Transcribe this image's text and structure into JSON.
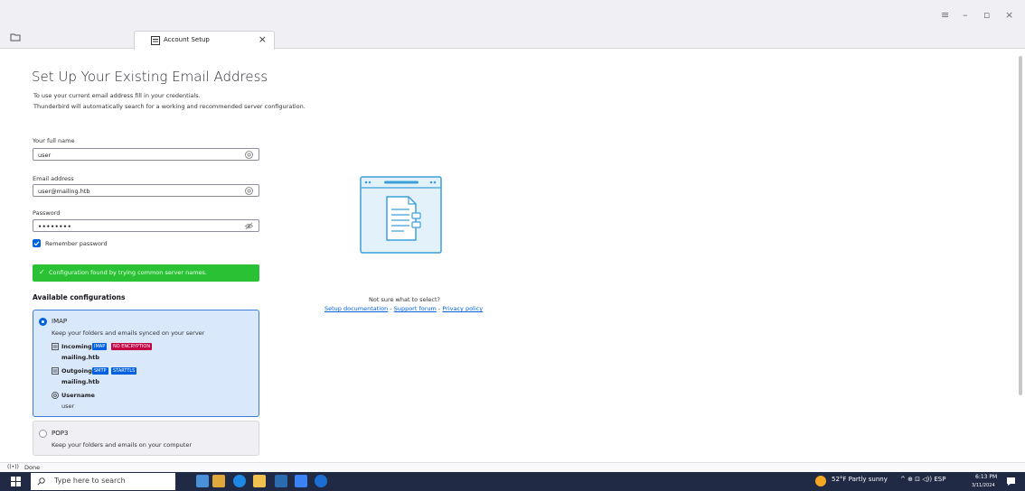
{
  "window": {
    "controls": {
      "menu": "≡",
      "minimize": "–",
      "restore": "▫",
      "close": "×"
    }
  },
  "tab": {
    "title": "Account Setup",
    "close": "×"
  },
  "page": {
    "title": "Set Up Your Existing Email Address",
    "intro_line1": "To use your current email address fill in your credentials.",
    "intro_line2": "Thunderbird will automatically search for a working and recommended server configuration."
  },
  "form": {
    "fullname_label": "Your full name",
    "fullname_value": "user",
    "email_label": "Email address",
    "email_value": "user@mailing.htb",
    "password_label": "Password",
    "password_value": "••••••••",
    "remember_label": "Remember password",
    "remember_checked": true
  },
  "status": {
    "check": "✓",
    "message": "Configuration found by trying common server names.",
    "color": "#2ac134"
  },
  "configs": {
    "title": "Available configurations",
    "imap": {
      "name": "IMAP",
      "desc": "Keep your folders and emails synced on your server",
      "incoming_label": "Incoming",
      "incoming_badge1": "IMAP",
      "incoming_badge2": "NO ENCRYPTION",
      "incoming_host": "mailing.htb",
      "outgoing_label": "Outgoing",
      "outgoing_badge1": "SMTP",
      "outgoing_badge2": "STARTTLS",
      "outgoing_host": "mailing.htb",
      "username_label": "Username",
      "username_value": "user"
    },
    "pop3": {
      "name": "POP3",
      "desc": "Keep your folders and emails on your computer"
    }
  },
  "help": {
    "question": "Not sure what to select?",
    "link1": "Setup documentation",
    "sep1": " - ",
    "link2": "Support forum",
    "sep2": " - ",
    "link3": "Privacy policy"
  },
  "statusline": {
    "icon": "((•))",
    "text": "Done"
  },
  "taskbar": {
    "search_placeholder": "Type here to search",
    "weather": "52°F  Partly sunny",
    "tray_icons": "^  ⊕  ⊡  ◁))  ESP",
    "time": "6:13 PM",
    "date": "3/11/2024"
  }
}
